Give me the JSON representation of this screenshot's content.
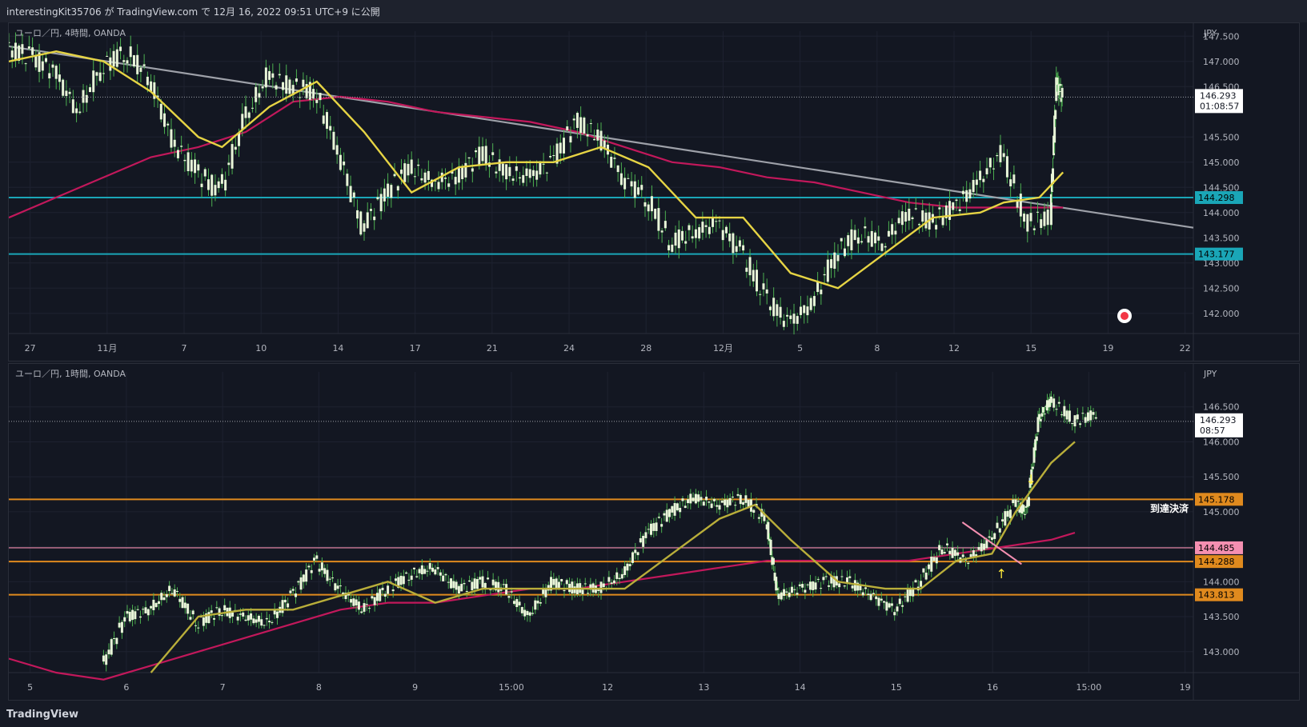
{
  "header": {
    "published": "interestingKit35706 が TradingView.com で 12月 16, 2022 09:51 UTC+9 に公開"
  },
  "footer": {
    "logo_text": "TradingView"
  },
  "colors": {
    "background": "#131722",
    "grid": "#1e2230",
    "candle": "#e8f5d8",
    "ma_fast": "#e6d444",
    "ma_fast_1h": "#b9ae3a",
    "ma_slow": "#c2185b",
    "trend_line": "#9ea1a9",
    "cyan_level": "#1aa6b7",
    "orange_level": "#e08a1e",
    "pink_level": "#f48fb1",
    "arrow": "#ffeb3b"
  },
  "chart_data": [
    {
      "type": "line",
      "title": "ユーロ／円, 4時間, OANDA",
      "currency": "JPY",
      "x_ticks": [
        "27",
        "11月",
        "7",
        "10",
        "14",
        "17",
        "21",
        "24",
        "28",
        "12月",
        "5",
        "8",
        "12",
        "15",
        "19",
        "22"
      ],
      "y_ticks": [
        "147.500",
        "147.000",
        "146.500",
        "145.500",
        "145.000",
        "144.500",
        "144.000",
        "143.500",
        "143.000",
        "142.500",
        "142.000"
      ],
      "ylim": [
        141.6,
        147.6
      ],
      "price_label": {
        "value": "146.293",
        "timer": "01:08:57"
      },
      "levels": [
        {
          "name": "resistance-cyan",
          "value": 144.298,
          "label": "144.298"
        },
        {
          "name": "support-cyan",
          "value": 143.177,
          "label": "143.177"
        }
      ],
      "trend_line": {
        "from": [
          0,
          147.3
        ],
        "to": [
          1,
          143.7
        ]
      },
      "price_series": [
        [
          0.0,
          147.25
        ],
        [
          0.02,
          147.1
        ],
        [
          0.04,
          146.8
        ],
        [
          0.06,
          146.0
        ],
        [
          0.08,
          146.9
        ],
        [
          0.1,
          147.2
        ],
        [
          0.12,
          146.7
        ],
        [
          0.14,
          145.4
        ],
        [
          0.16,
          144.8
        ],
        [
          0.18,
          144.4
        ],
        [
          0.2,
          145.8
        ],
        [
          0.22,
          146.7
        ],
        [
          0.24,
          146.5
        ],
        [
          0.26,
          146.4
        ],
        [
          0.28,
          145.2
        ],
        [
          0.3,
          143.7
        ],
        [
          0.32,
          144.4
        ],
        [
          0.34,
          144.9
        ],
        [
          0.36,
          144.6
        ],
        [
          0.38,
          144.7
        ],
        [
          0.4,
          145.2
        ],
        [
          0.42,
          144.8
        ],
        [
          0.44,
          144.7
        ],
        [
          0.46,
          145.0
        ],
        [
          0.48,
          145.8
        ],
        [
          0.5,
          145.5
        ],
        [
          0.52,
          144.7
        ],
        [
          0.54,
          144.3
        ],
        [
          0.56,
          143.4
        ],
        [
          0.58,
          143.6
        ],
        [
          0.6,
          143.8
        ],
        [
          0.62,
          143.2
        ],
        [
          0.64,
          142.3
        ],
        [
          0.66,
          141.8
        ],
        [
          0.68,
          142.2
        ],
        [
          0.7,
          143.2
        ],
        [
          0.72,
          143.6
        ],
        [
          0.74,
          143.4
        ],
        [
          0.76,
          144.0
        ],
        [
          0.78,
          143.8
        ],
        [
          0.8,
          144.1
        ],
        [
          0.82,
          144.6
        ],
        [
          0.84,
          145.2
        ],
        [
          0.86,
          143.8
        ],
        [
          0.88,
          143.9
        ],
        [
          0.885,
          146.6
        ],
        [
          0.89,
          146.3
        ]
      ],
      "ma_fast": [
        [
          0.0,
          147.0
        ],
        [
          0.04,
          147.2
        ],
        [
          0.08,
          147.0
        ],
        [
          0.12,
          146.4
        ],
        [
          0.16,
          145.5
        ],
        [
          0.18,
          145.3
        ],
        [
          0.22,
          146.1
        ],
        [
          0.26,
          146.6
        ],
        [
          0.3,
          145.6
        ],
        [
          0.34,
          144.4
        ],
        [
          0.38,
          144.9
        ],
        [
          0.42,
          145.0
        ],
        [
          0.46,
          145.0
        ],
        [
          0.5,
          145.3
        ],
        [
          0.54,
          144.9
        ],
        [
          0.58,
          143.9
        ],
        [
          0.62,
          143.9
        ],
        [
          0.66,
          142.8
        ],
        [
          0.7,
          142.5
        ],
        [
          0.74,
          143.2
        ],
        [
          0.78,
          143.9
        ],
        [
          0.82,
          144.0
        ],
        [
          0.84,
          144.2
        ],
        [
          0.87,
          144.3
        ],
        [
          0.89,
          144.8
        ]
      ],
      "ma_slow": [
        [
          0.0,
          143.9
        ],
        [
          0.04,
          144.3
        ],
        [
          0.08,
          144.7
        ],
        [
          0.12,
          145.1
        ],
        [
          0.16,
          145.3
        ],
        [
          0.2,
          145.6
        ],
        [
          0.24,
          146.2
        ],
        [
          0.28,
          146.3
        ],
        [
          0.32,
          146.2
        ],
        [
          0.36,
          146.0
        ],
        [
          0.4,
          145.9
        ],
        [
          0.44,
          145.8
        ],
        [
          0.48,
          145.6
        ],
        [
          0.52,
          145.3
        ],
        [
          0.56,
          145.0
        ],
        [
          0.6,
          144.9
        ],
        [
          0.64,
          144.7
        ],
        [
          0.68,
          144.6
        ],
        [
          0.72,
          144.4
        ],
        [
          0.76,
          144.2
        ],
        [
          0.8,
          144.1
        ],
        [
          0.84,
          144.1
        ],
        [
          0.87,
          144.1
        ],
        [
          0.89,
          144.1
        ]
      ]
    },
    {
      "type": "line",
      "title": "ユーロ／円, 1時間, OANDA",
      "currency": "JPY",
      "x_ticks": [
        "5",
        "6",
        "7",
        "8",
        "9",
        "15:00",
        "12",
        "13",
        "14",
        "15",
        "16",
        "15:00",
        "19"
      ],
      "y_ticks": [
        "146.500",
        "146.000",
        "145.500",
        "145.000",
        "144.500",
        "144.000",
        "143.500",
        "143.000"
      ],
      "ylim": [
        142.7,
        147.0
      ],
      "price_label": {
        "value": "146.293",
        "timer": "08:57"
      },
      "levels": [
        {
          "name": "level-145178",
          "value": 145.178,
          "label": "145.178",
          "color": "orange"
        },
        {
          "name": "level-144485",
          "value": 144.485,
          "label": "144.485",
          "color": "pink"
        },
        {
          "name": "level-144288",
          "value": 144.288,
          "label": "144.288",
          "color": "orange"
        },
        {
          "name": "level-143813",
          "value": 143.813,
          "label": "143.813",
          "color": "orange"
        }
      ],
      "annotation": "到達決済",
      "price_series": [
        [
          0.08,
          142.8
        ],
        [
          0.1,
          143.5
        ],
        [
          0.12,
          143.6
        ],
        [
          0.14,
          143.9
        ],
        [
          0.16,
          143.4
        ],
        [
          0.18,
          143.6
        ],
        [
          0.2,
          143.5
        ],
        [
          0.22,
          143.4
        ],
        [
          0.24,
          143.8
        ],
        [
          0.26,
          144.3
        ],
        [
          0.28,
          143.9
        ],
        [
          0.3,
          143.6
        ],
        [
          0.32,
          143.9
        ],
        [
          0.34,
          144.1
        ],
        [
          0.36,
          144.2
        ],
        [
          0.38,
          143.9
        ],
        [
          0.4,
          144.0
        ],
        [
          0.42,
          143.9
        ],
        [
          0.44,
          143.5
        ],
        [
          0.46,
          144.0
        ],
        [
          0.48,
          143.9
        ],
        [
          0.5,
          143.9
        ],
        [
          0.52,
          144.1
        ],
        [
          0.54,
          144.7
        ],
        [
          0.56,
          145.0
        ],
        [
          0.58,
          145.2
        ],
        [
          0.6,
          145.1
        ],
        [
          0.62,
          145.2
        ],
        [
          0.64,
          144.9
        ],
        [
          0.65,
          143.8
        ],
        [
          0.67,
          143.9
        ],
        [
          0.69,
          144.0
        ],
        [
          0.71,
          144.0
        ],
        [
          0.73,
          143.8
        ],
        [
          0.75,
          143.6
        ],
        [
          0.77,
          144.0
        ],
        [
          0.79,
          144.5
        ],
        [
          0.81,
          144.3
        ],
        [
          0.83,
          144.6
        ],
        [
          0.85,
          145.1
        ],
        [
          0.86,
          145.0
        ],
        [
          0.87,
          146.3
        ],
        [
          0.88,
          146.6
        ],
        [
          0.9,
          146.3
        ],
        [
          0.92,
          146.4
        ]
      ],
      "ma_fast": [
        [
          0.12,
          142.7
        ],
        [
          0.16,
          143.5
        ],
        [
          0.2,
          143.6
        ],
        [
          0.24,
          143.6
        ],
        [
          0.28,
          143.8
        ],
        [
          0.32,
          144.0
        ],
        [
          0.36,
          143.7
        ],
        [
          0.4,
          143.9
        ],
        [
          0.44,
          143.9
        ],
        [
          0.48,
          143.9
        ],
        [
          0.52,
          143.9
        ],
        [
          0.56,
          144.4
        ],
        [
          0.6,
          144.9
        ],
        [
          0.63,
          145.1
        ],
        [
          0.66,
          144.6
        ],
        [
          0.7,
          144.0
        ],
        [
          0.74,
          143.9
        ],
        [
          0.77,
          143.9
        ],
        [
          0.8,
          144.3
        ],
        [
          0.83,
          144.4
        ],
        [
          0.85,
          145.0
        ],
        [
          0.88,
          145.7
        ],
        [
          0.9,
          146.0
        ]
      ],
      "ma_slow": [
        [
          0.0,
          142.9
        ],
        [
          0.04,
          142.7
        ],
        [
          0.08,
          142.6
        ],
        [
          0.12,
          142.8
        ],
        [
          0.16,
          143.0
        ],
        [
          0.2,
          143.2
        ],
        [
          0.24,
          143.4
        ],
        [
          0.28,
          143.6
        ],
        [
          0.32,
          143.7
        ],
        [
          0.36,
          143.7
        ],
        [
          0.4,
          143.8
        ],
        [
          0.44,
          143.9
        ],
        [
          0.48,
          143.9
        ],
        [
          0.52,
          144.0
        ],
        [
          0.56,
          144.1
        ],
        [
          0.6,
          144.2
        ],
        [
          0.64,
          144.3
        ],
        [
          0.68,
          144.3
        ],
        [
          0.72,
          144.3
        ],
        [
          0.76,
          144.3
        ],
        [
          0.8,
          144.4
        ],
        [
          0.84,
          144.5
        ],
        [
          0.88,
          144.6
        ],
        [
          0.9,
          144.7
        ]
      ]
    }
  ]
}
